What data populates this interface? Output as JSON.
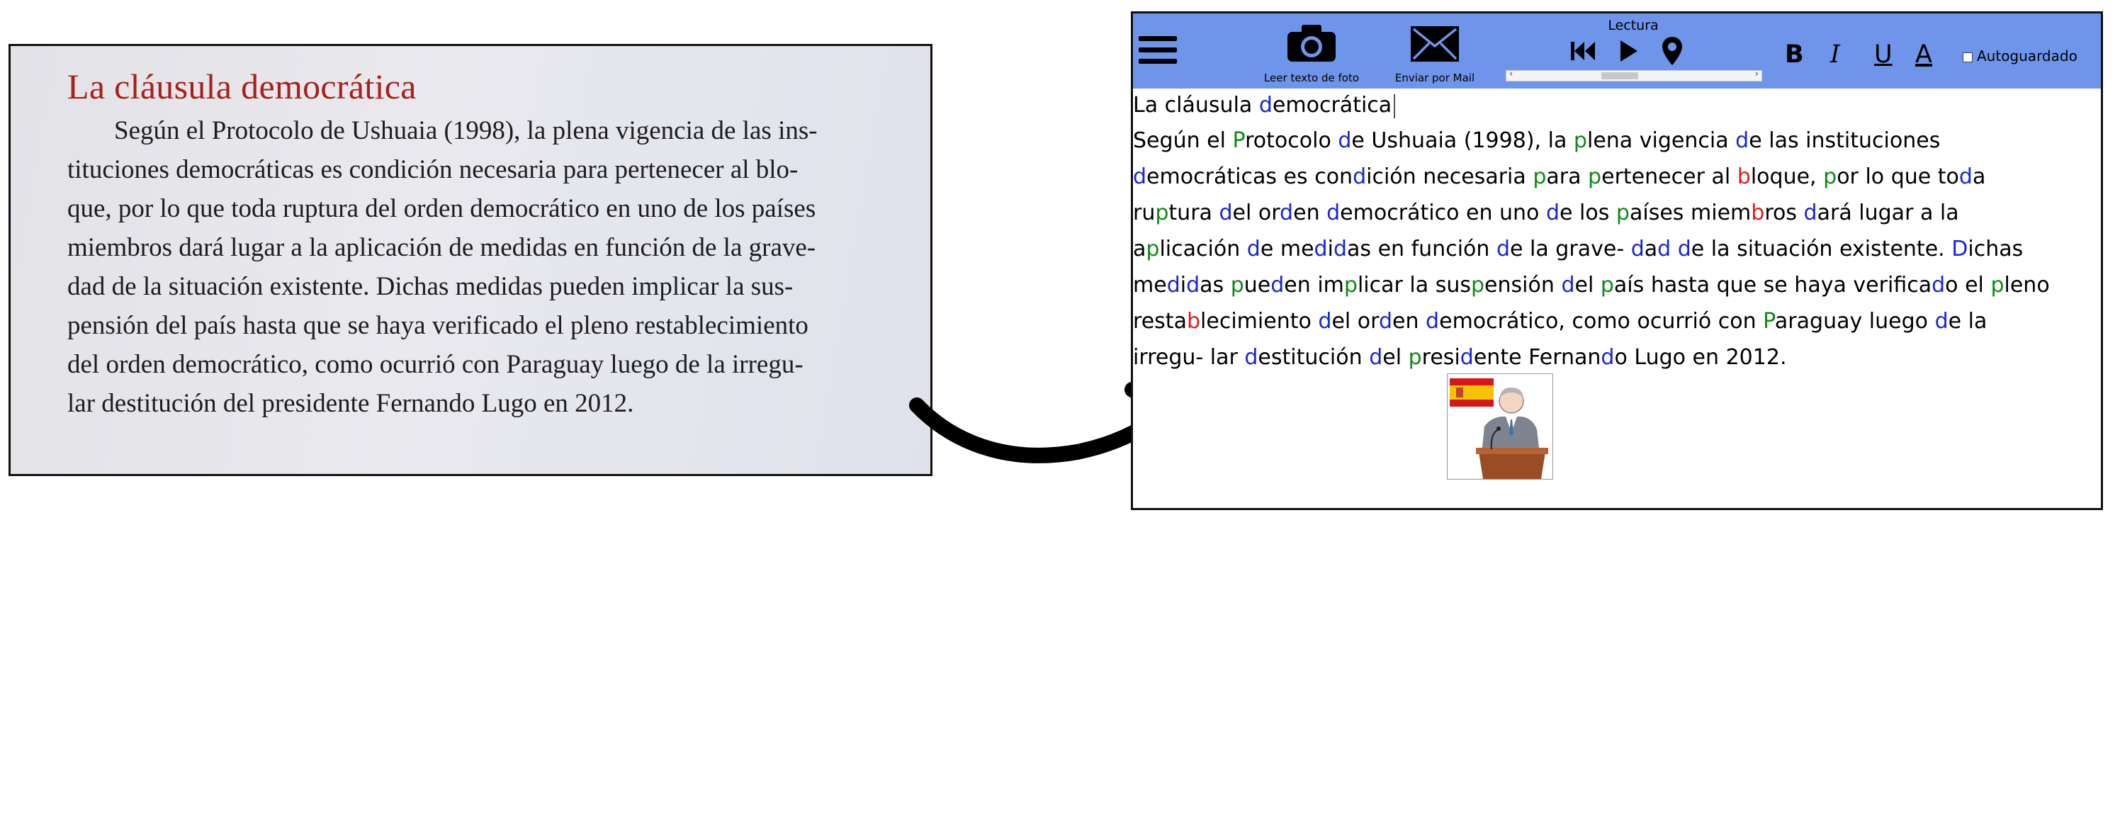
{
  "book": {
    "title": "La cláusula democrática",
    "lines": [
      "Según el Protocolo de Ushuaia (1998), la plena vigencia de las ins-",
      "tituciones democráticas es condición necesaria para pertenecer al blo-",
      "que, por lo que toda ruptura del orden democrático en uno de los países",
      "miembros dará lugar a la aplicación de medidas en función de la grave-",
      "dad de la situación existente. Dichas medidas pueden implicar la sus-",
      "pensión del país hasta que se haya verificado el pleno restablecimiento",
      "del orden democrático, como ocurrió con Paraguay luego de la irregu-",
      "lar destitución del presidente Fernando Lugo en 2012."
    ]
  },
  "toolbar": {
    "photo_label": "Leer texto de foto",
    "mail_label": "Enviar por Mail",
    "reading_label": "Lectura",
    "bold": "B",
    "italic": "I",
    "underline": "U",
    "text_color": "A",
    "autosave_label": "Autoguardado"
  },
  "editor": {
    "title": "La cláusula democrática",
    "lines": [
      "Según el Protocolo de Ushuaia (1998), la plena vigencia de las instituciones",
      "democráticas es condición necesaria para pertenecer al bloque, por lo que toda",
      "ruptura del orden democrático en uno de los países miembros dará lugar a la",
      "aplicación de medidas en función de la grave- dad de la situación existente. Dichas",
      "medidas pueden implicar la suspensión del país hasta que se haya verificado el pleno",
      "restablecimiento del orden democrático, como ocurrió con Paraguay luego de la",
      "irregu- lar destitución del presidente Fernando Lugo en 2012."
    ]
  },
  "colors": {
    "toolbar_bg": "#6e95ea",
    "book_title": "#a8201b",
    "letter_d": "#1a25d8",
    "letter_p": "#0f8a14",
    "letter_b": "#e01b1b"
  },
  "icons": [
    "menu-icon",
    "camera-icon",
    "mail-icon",
    "skip-back-icon",
    "play-icon",
    "location-pin-icon",
    "spain-flag-icon",
    "president-pictogram"
  ]
}
